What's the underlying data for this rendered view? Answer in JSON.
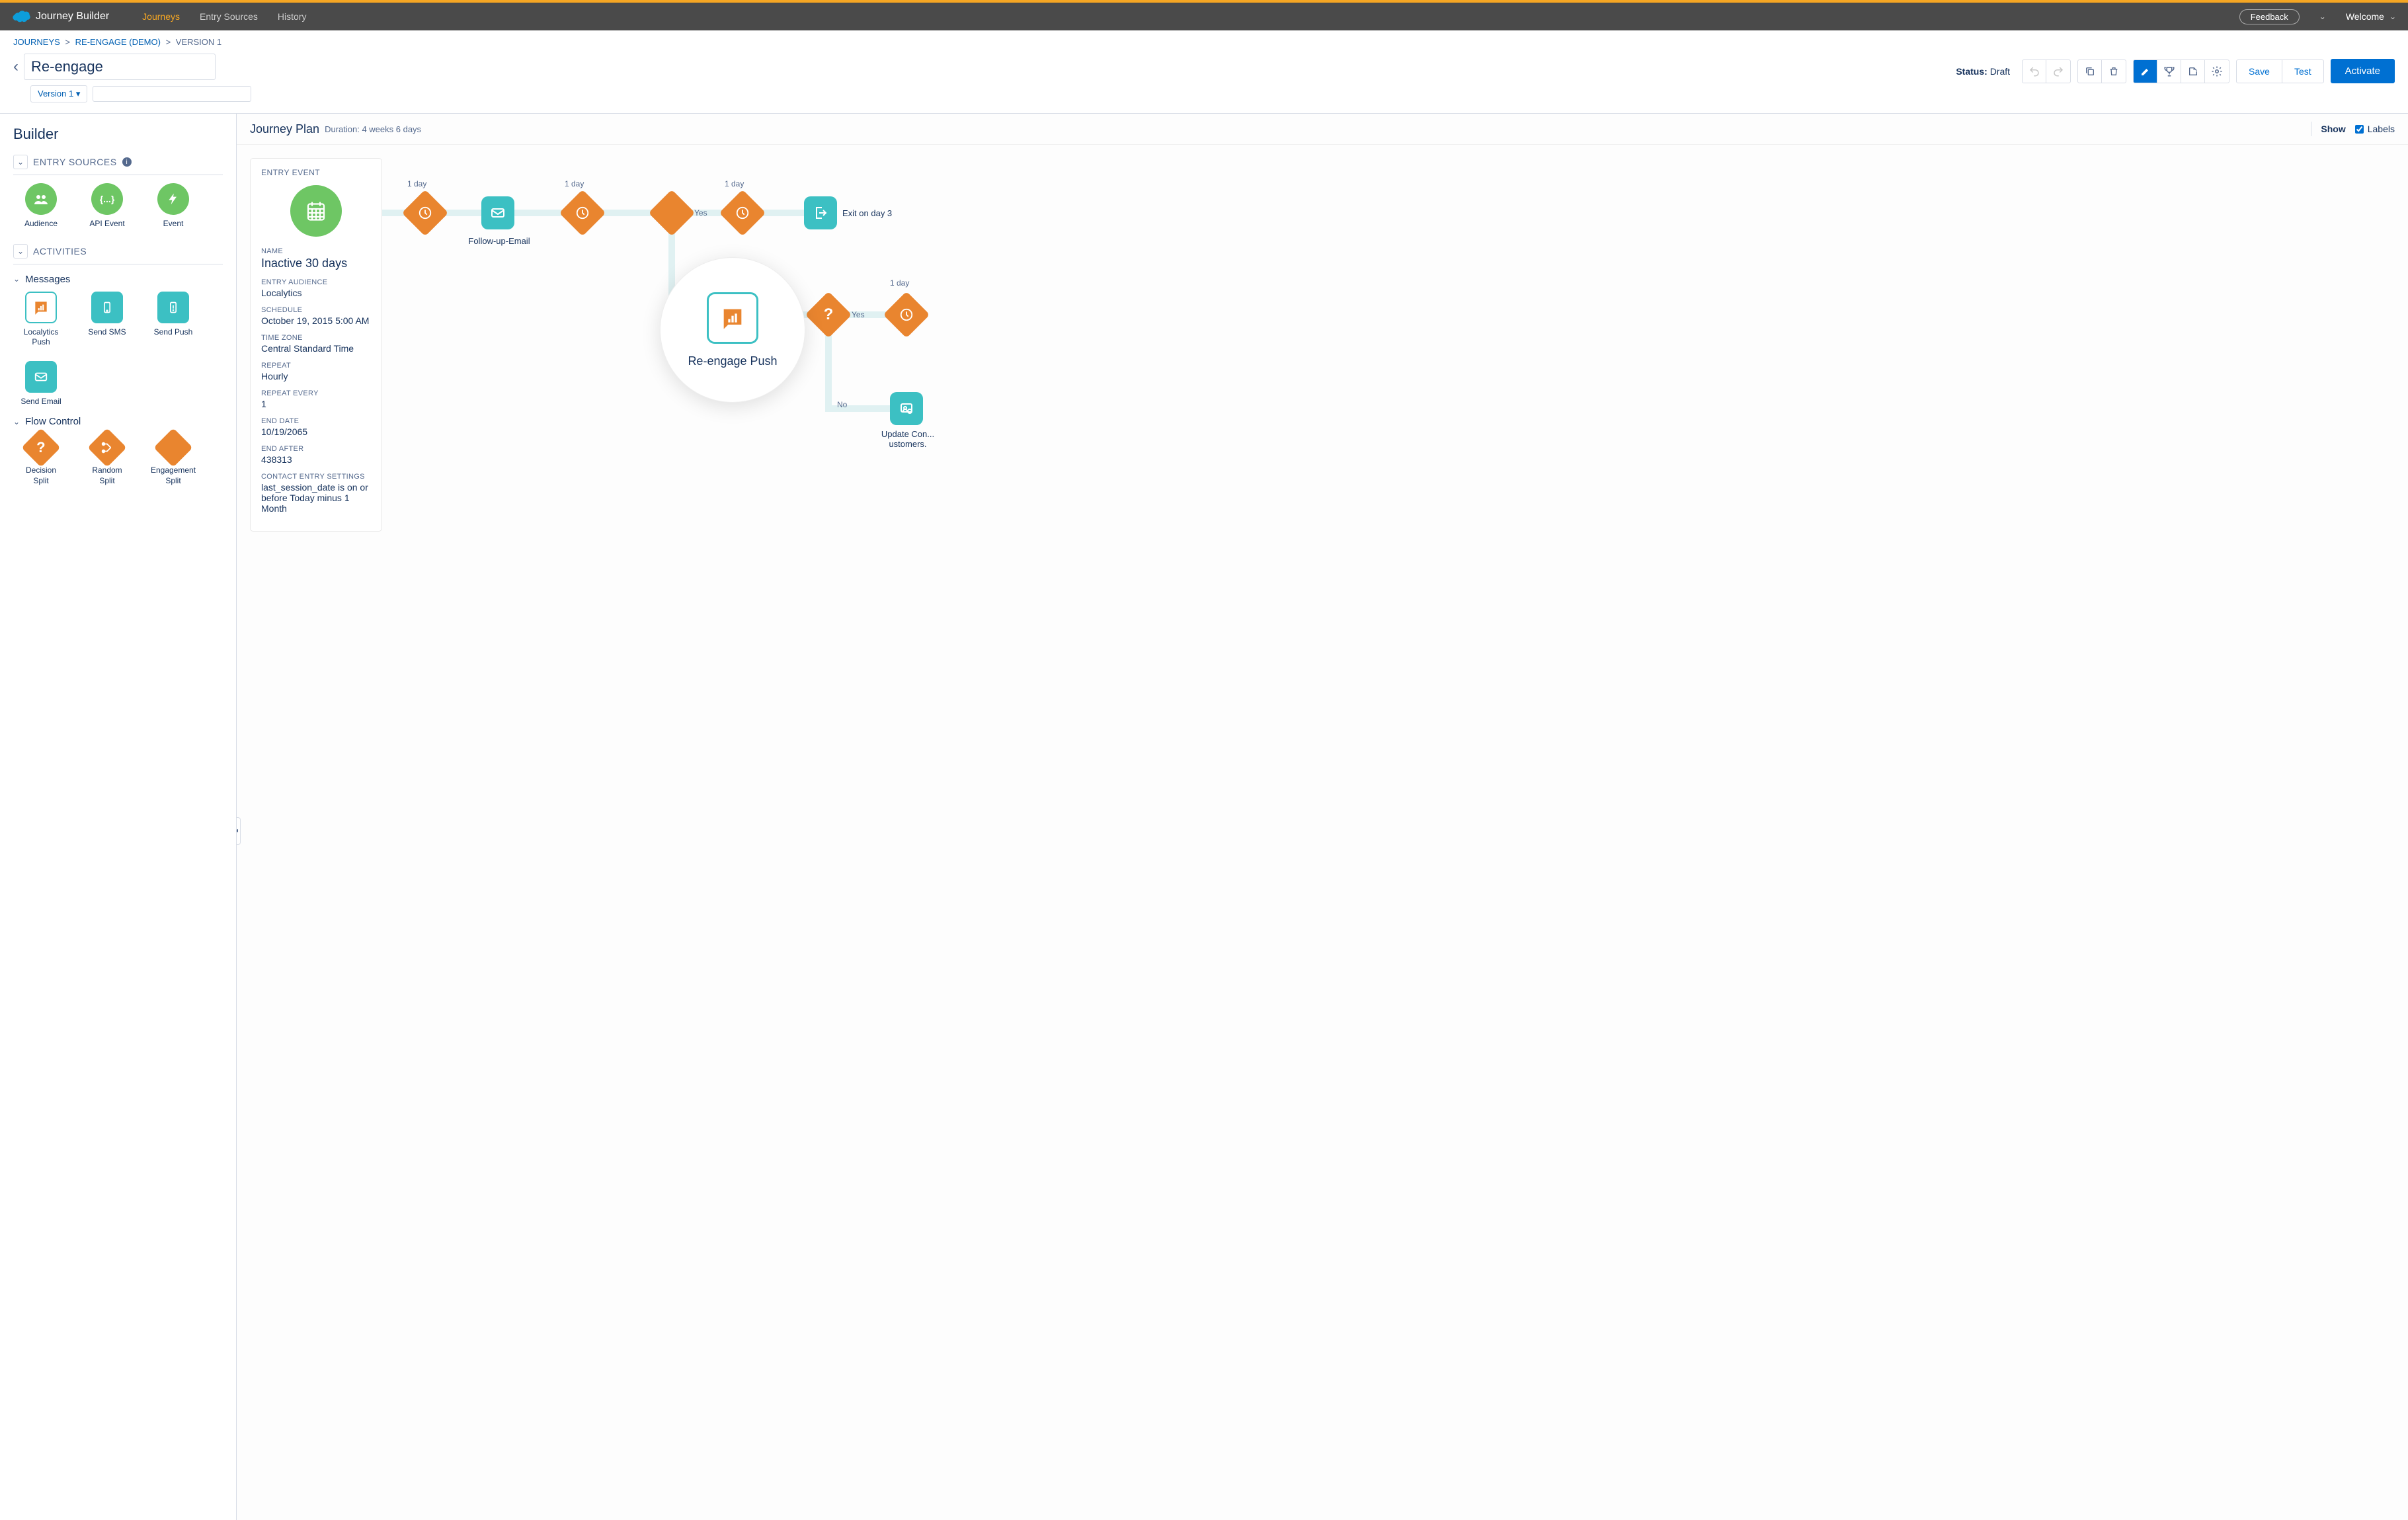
{
  "app": {
    "title": "Journey Builder"
  },
  "nav": {
    "journeys": "Journeys",
    "entry_sources": "Entry Sources",
    "history": "History"
  },
  "topbar": {
    "feedback": "Feedback",
    "welcome": "Welcome"
  },
  "breadcrumb": {
    "journeys": "JOURNEYS",
    "parent": "RE-ENGAGE (DEMO)",
    "current": "VERSION 1",
    "sep": ">"
  },
  "editor": {
    "title_value": "Re-engage",
    "version_label": "Version 1 ▾",
    "status_label": "Status:",
    "status_value": "Draft",
    "save": "Save",
    "test": "Test",
    "activate": "Activate"
  },
  "builder": {
    "title": "Builder",
    "entry_sources_label": "ENTRY SOURCES",
    "activities_label": "ACTIVITIES",
    "messages_label": "Messages",
    "flow_control_label": "Flow Control",
    "tiles": {
      "audience": "Audience",
      "api_event": "API Event",
      "event": "Event",
      "localytics_push": "Localytics Push",
      "send_sms": "Send SMS",
      "send_push": "Send Push",
      "send_email": "Send Email",
      "decision_split": "Decision Split",
      "random_split": "Random Split",
      "engagement_split": "Engagement Split"
    }
  },
  "plan": {
    "title": "Journey Plan",
    "duration_label": "Duration:",
    "duration_value": "4 weeks 6 days",
    "show": "Show",
    "labels": "Labels"
  },
  "entry": {
    "card_title": "ENTRY EVENT",
    "name_l": "NAME",
    "name_v": "Inactive 30 days",
    "aud_l": "ENTRY AUDIENCE",
    "aud_v": "Localytics",
    "sched_l": "SCHEDULE",
    "sched_v": "October 19, 2015 5:00 AM",
    "tz_l": "TIME ZONE",
    "tz_v": "Central Standard Time",
    "repeat_l": "REPEAT",
    "repeat_v": "Hourly",
    "revery_l": "REPEAT EVERY",
    "revery_v": "1",
    "end_l": "END DATE",
    "end_v": "10/19/2065",
    "endafter_l": "END AFTER",
    "endafter_v": "438313",
    "ces_l": "CONTACT ENTRY SETTINGS",
    "ces_v": "last_session_date is on or before Today minus 1 Month"
  },
  "nodes": {
    "day1a": "1 day",
    "day1b": "1 day",
    "day1c": "1 day",
    "day1d": "1 day",
    "followup": "Follow-up-Email",
    "exit": "Exit on day 3",
    "yes1": "Yes",
    "yes2": "Yes",
    "no2": "No",
    "zoom_label": "Re-engage Push",
    "update_con": "Update Con... ustomers."
  }
}
